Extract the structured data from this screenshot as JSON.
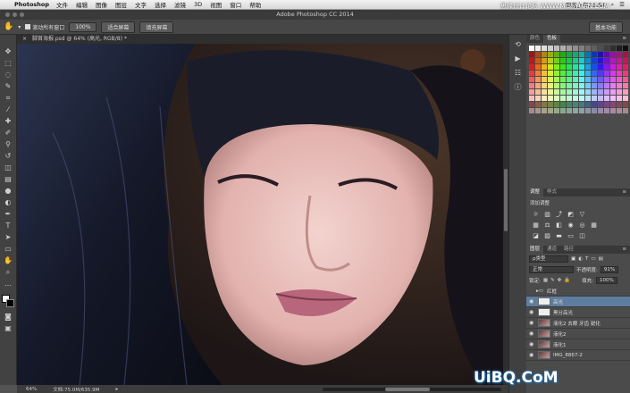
{
  "menubar": {
    "app": "Photoshop",
    "items": [
      "文件",
      "编辑",
      "图像",
      "图层",
      "文字",
      "选择",
      "滤镜",
      "3D",
      "视图",
      "窗口",
      "帮助"
    ],
    "clock": "周五上午21:54",
    "watermark_top": "思缘设计论坛 WWW.MISSYUAN.COM"
  },
  "titlebar": {
    "title": "Adobe Photoshop CC 2014"
  },
  "options": {
    "scroll_all_label": "滚动所有窗口",
    "zoom100": "100%",
    "fit_screen": "适合屏幕",
    "fill_screen": "填充屏幕",
    "workspace": "基本功能"
  },
  "document": {
    "tab_label": "脚首海报.psd @ 64% (高光, RGB/8) *"
  },
  "status": {
    "zoom": "64%",
    "doc_size": "文档:75.0M/635.9M"
  },
  "panels": {
    "color_tabs": [
      "颜色",
      "色板"
    ],
    "adjust_tabs": [
      "调整",
      "样式"
    ],
    "add_adjustment": "添加调整",
    "layers_tabs": [
      "图层",
      "通道",
      "路径"
    ],
    "kind_label": "ρ类型",
    "blend_mode": "正常",
    "opacity_label": "不透明度:",
    "opacity_value": "91%",
    "lock_label": "锁定:",
    "fill_label": "填充:",
    "fill_value": "100%",
    "layers": [
      {
        "name": "红框",
        "type": "group",
        "visible": false
      },
      {
        "name": "高光",
        "type": "white",
        "visible": true,
        "active": true
      },
      {
        "name": "黑分高光",
        "type": "white",
        "visible": true
      },
      {
        "name": "液化2 去眼 牙齿 锐化",
        "type": "photo",
        "visible": true
      },
      {
        "name": "液化2",
        "type": "photo",
        "visible": true
      },
      {
        "name": "液化1",
        "type": "photo",
        "visible": true
      },
      {
        "name": "IMG_8867-2",
        "type": "photo",
        "visible": true
      }
    ]
  },
  "watermark": "UiBQ.CoM",
  "colors": {
    "accent_layer": "#5e7ea0",
    "app_bg": "#535353"
  }
}
